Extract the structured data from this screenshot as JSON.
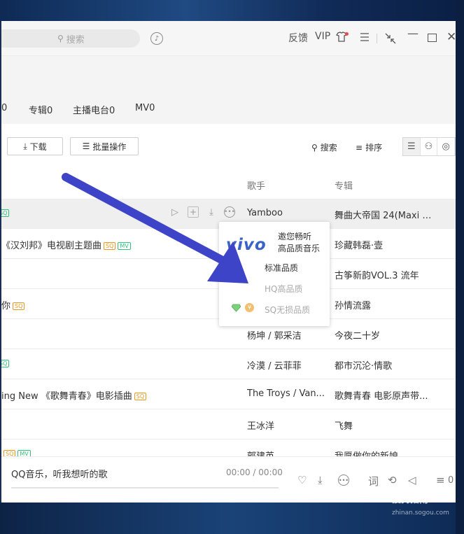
{
  "titlebar": {
    "search_placeholder": "搜索",
    "feedback": "反馈",
    "vip": "VIP",
    "icons": [
      "music-note-icon",
      "skin-icon",
      "menu-icon",
      "mini-mode-icon",
      "minimize-icon",
      "maximize-icon",
      "close-icon"
    ]
  },
  "tabs": [
    {
      "label": "0"
    },
    {
      "label": "专辑0"
    },
    {
      "label": "主播电台0"
    },
    {
      "label": "MV0"
    }
  ],
  "toolbar": {
    "download": "下载",
    "batch": "批量操作",
    "search": "搜索",
    "sort": "排序"
  },
  "columns": {
    "artist": "歌手",
    "album": "专辑"
  },
  "songs": [
    {
      "title": "",
      "artist": "Yamboo",
      "album": "舞曲大帝国 24(Maxi K...",
      "badges": [
        "SQ"
      ]
    },
    {
      "title": "《汉刘邦》电视剧主题曲",
      "artist": "",
      "album": "珍藏韩磊·壹",
      "badges": [
        "SQ",
        "MV"
      ]
    },
    {
      "title": "",
      "artist": "",
      "album": "古筝新韵VOL.3 流年",
      "badges": []
    },
    {
      "title": "你",
      "artist": "",
      "album": "孙情流露",
      "badges": [
        "SQ"
      ]
    },
    {
      "title": "",
      "artist": "杨坤 / 郭采洁",
      "album": "今夜二十岁",
      "badges": []
    },
    {
      "title": "",
      "artist": "冷漠 / 云菲菲",
      "album": "都市沉沦·情歌",
      "badges": [
        "SQ"
      ]
    },
    {
      "title": "ing New 《歌舞青春》电影插曲",
      "artist": "The Troys / Van...",
      "album": "歌舞青春 电影原声带...",
      "badges": [
        "SQ"
      ]
    },
    {
      "title": "",
      "artist": "王冰洋",
      "album": "飞舞",
      "badges": []
    },
    {
      "title": "",
      "artist": "郭建英",
      "album": "我愿做你的新娘",
      "badges": [
        "SQ",
        "MV"
      ]
    }
  ],
  "popup": {
    "brand": "vivo",
    "tagline_line1": "邀您畅听",
    "tagline_line2": "高品质音乐",
    "standard": "标准品质",
    "hq": "HQ高品质",
    "sq": "SQ无损品质"
  },
  "player": {
    "now_playing": "QQ音乐，听我想听的歌",
    "time": "00:00 / 00:00",
    "lyrics": "词",
    "playlist_count": "0"
  },
  "watermark": {
    "name": "搜狗指南",
    "url": "zhinan.sogou.com"
  },
  "colors": {
    "accent_green": "#31c27c",
    "sq_orange": "#e8981c",
    "arrow": "#3d44c8",
    "vivo_blue": "#3a62c8"
  }
}
